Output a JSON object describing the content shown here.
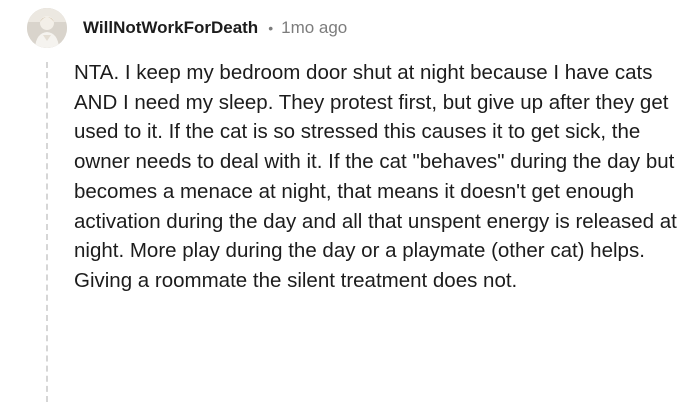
{
  "comment": {
    "username": "WillNotWorkForDeath",
    "separator": "•",
    "timestamp": "1mo ago",
    "body": "NTA. I keep my bedroom door shut at night because I have cats AND I need my sleep. They protest first, but give up after they get used to it. If the cat is so stressed this causes it to get sick, the owner needs to deal with it. If the cat \"behaves\" during the day but becomes a menace at night, that means it doesn't get enough activation during the day and all that unspent energy is released at night. More play during the day or a playmate (other cat) helps. Giving a roommate the silent treatment does not."
  },
  "avatar": {
    "icon": "user-avatar",
    "background": "#d9d4cc"
  },
  "colors": {
    "text": "#1c1c1c",
    "meta": "#7c7c7c",
    "thread_line": "#d6d6d6"
  }
}
